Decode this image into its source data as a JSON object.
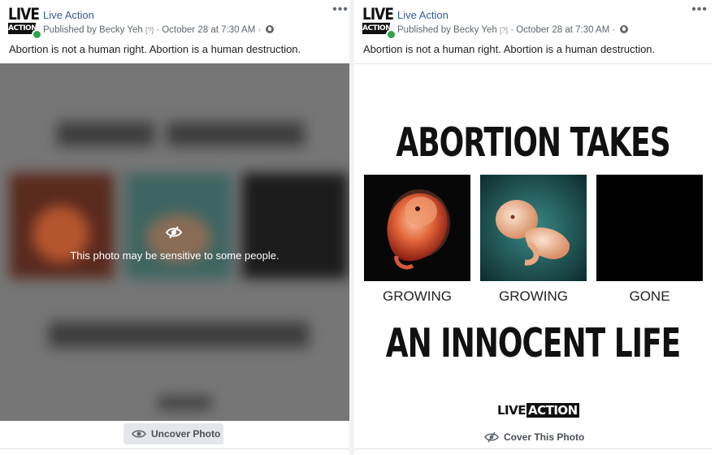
{
  "posts": [
    {
      "page_name": "Live Action",
      "published_by": "Published by Becky Yeh",
      "help_marker": "[?]",
      "timestamp": "October 28 at 7:30 AM",
      "separator": "·",
      "text": "Abortion is not a human right. Abortion is a human destruction.",
      "logo_top": "LIVE",
      "logo_bottom": "ACTION",
      "more": "•••",
      "sensitive_warning": "This photo may be sensitive to some people.",
      "button_label": "Uncover Photo",
      "icons": [
        "eye-slash-icon",
        "eye-icon",
        "globe-icon",
        "more-icon"
      ]
    },
    {
      "page_name": "Live Action",
      "published_by": "Published by Becky Yeh",
      "help_marker": "[?]",
      "timestamp": "October 28 at 7:30 AM",
      "separator": "·",
      "text": "Abortion is not a human right. Abortion is a human destruction.",
      "logo_top": "LIVE",
      "logo_bottom": "ACTION",
      "more": "•••",
      "image": {
        "headline_top": "ABORTION TAKES",
        "headline_bottom": "AN INNOCENT LIFE",
        "stages": [
          "GROWING",
          "GROWING",
          "GONE"
        ],
        "brand_left": "LIVE",
        "brand_right": "ACTION"
      },
      "button_label": "Cover This Photo",
      "icons": [
        "eye-slash-icon",
        "globe-icon",
        "more-icon"
      ]
    }
  ],
  "colors": {
    "link": "#385898",
    "meta": "#606770",
    "online": "#31a24c",
    "blur_background": "#767676",
    "button_background": "#e4e6eb"
  }
}
